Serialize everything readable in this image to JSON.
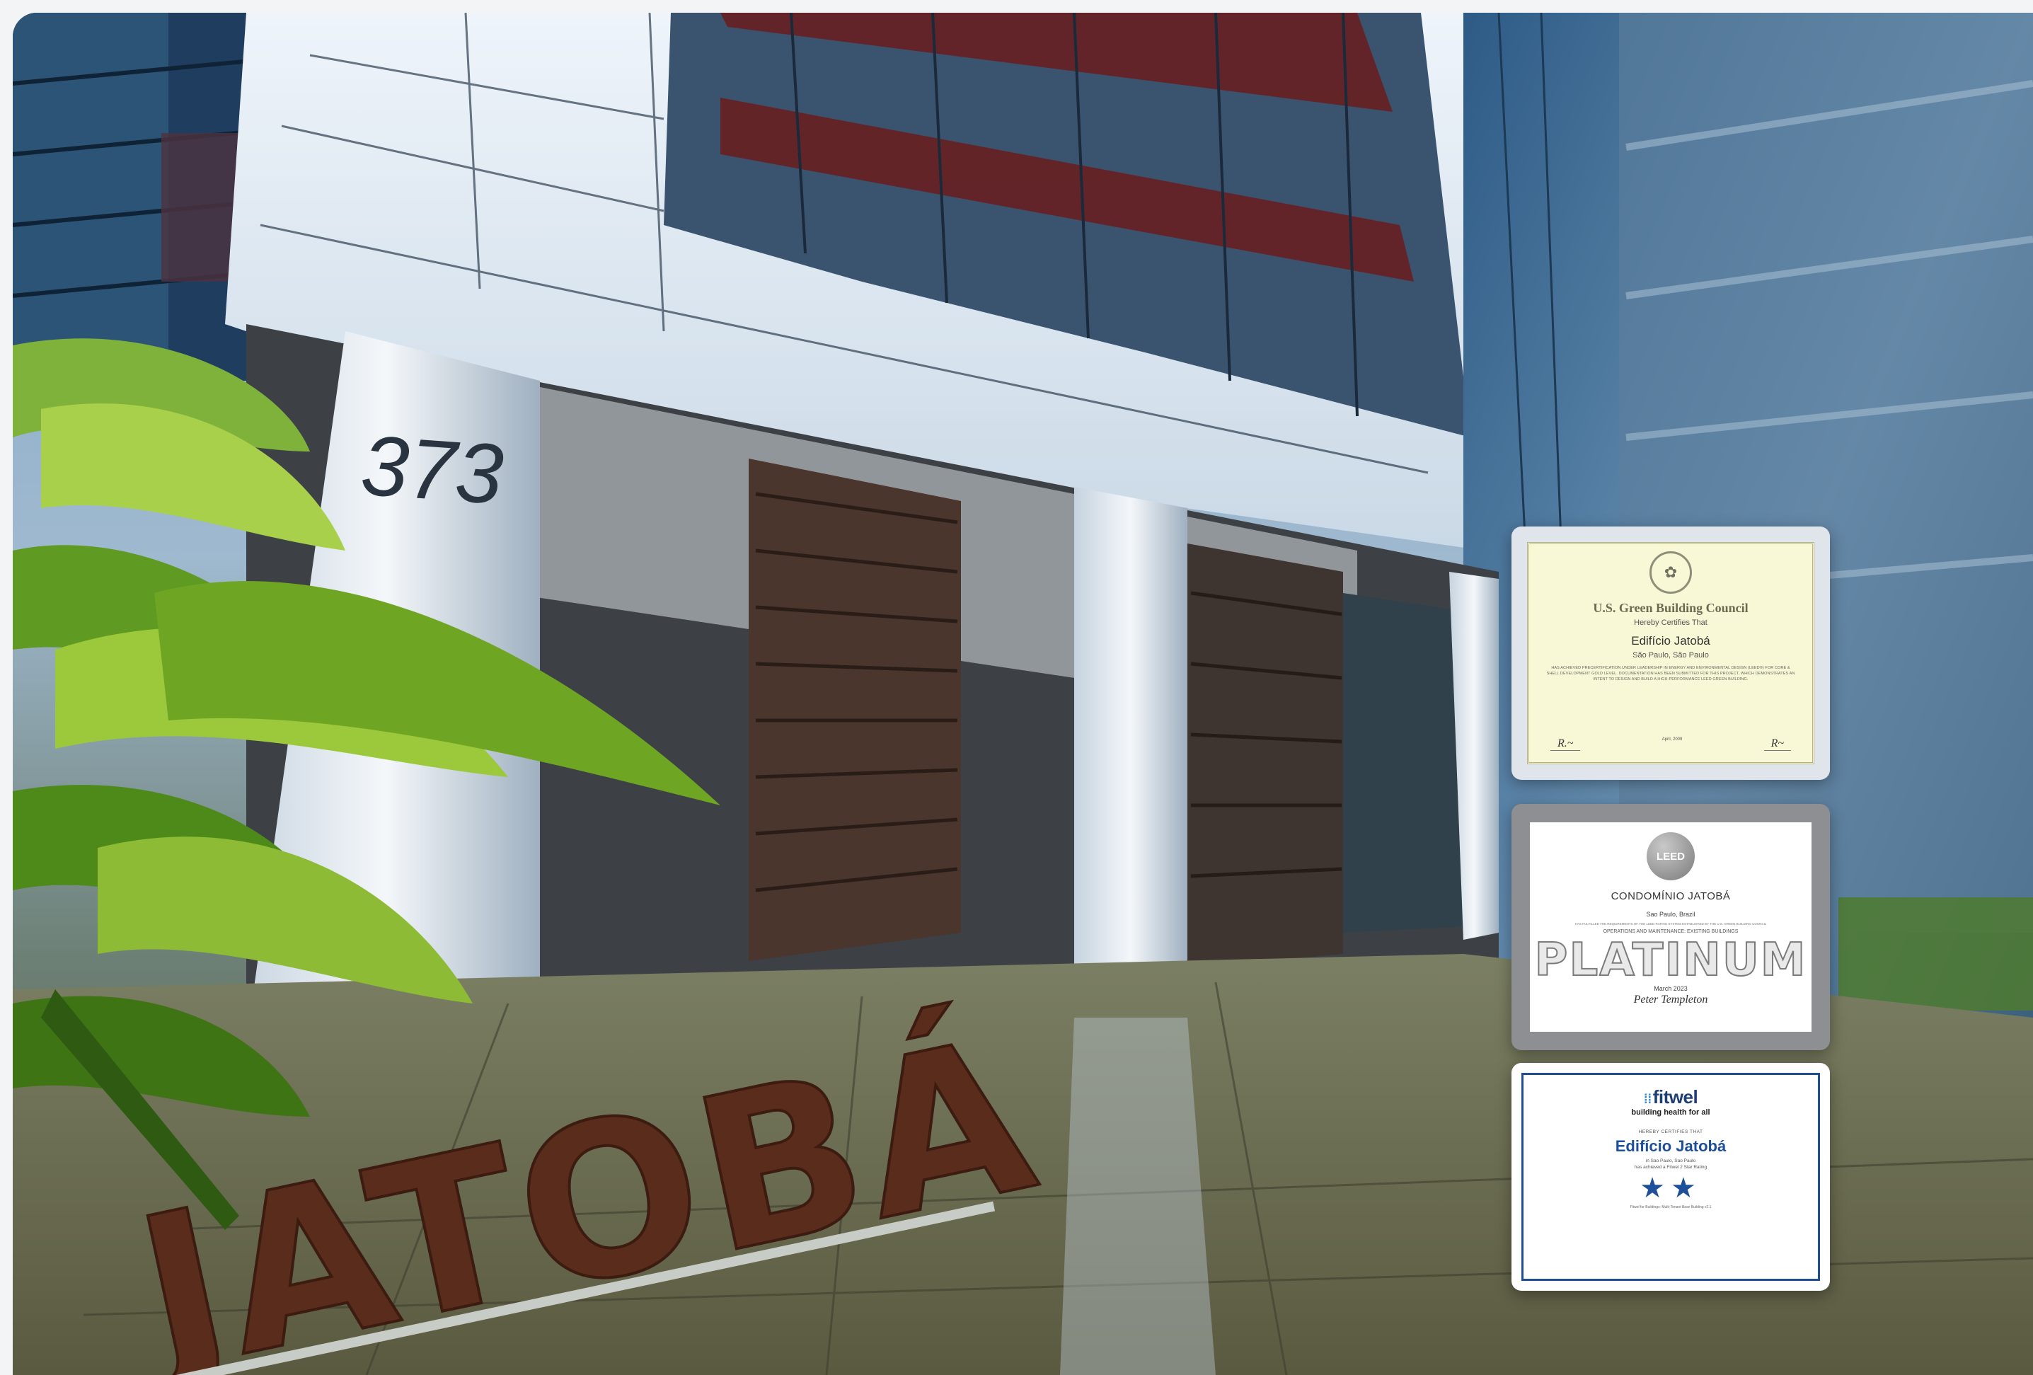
{
  "building": {
    "street_number": "373",
    "sign_lettering": "JATOBÁ"
  },
  "certificates": {
    "usgbc": {
      "organization": "U.S. Green Building Council",
      "certifies": "Hereby Certifies That",
      "building_name": "Edifício Jatobá",
      "location": "São Paulo, São Paulo",
      "body": "HAS ACHIEVED PRECERTIFICATION UNDER LEADERSHIP IN ENERGY AND ENVIRONMENTAL DESIGN (LEED®) FOR CORE & SHELL DEVELOPMENT GOLD LEVEL. DOCUMENTATION HAS BEEN SUBMITTED FOR THIS PROJECT, WHICH DEMONSTRATES AN INTENT TO DESIGN AND BUILD A HIGH-PERFORMANCE LEED GREEN BUILDING.",
      "date": "April, 2009"
    },
    "leed": {
      "seal": "LEED",
      "building_name": "CONDOMÍNIO JATOBÁ",
      "location": "Sao Paulo, Brazil",
      "fine_print": "HAS FULFILLED THE REQUIREMENTS OF THE LEED RATING SYSTEM ESTABLISHED BY THE U.S. GREEN BUILDING COUNCIL",
      "rating_system": "OPERATIONS AND MAINTENANCE: EXISTING BUILDINGS",
      "level": "PLATINUM",
      "date": "March 2023"
    },
    "fitwel": {
      "logo": "fitwel",
      "tagline": "building health for all",
      "certifies": "HEREBY CERTIFIES THAT",
      "building_name": "Edifício Jatobá",
      "location": "in Sao Paulo, Sao Paulo",
      "achievement": "has achieved a Fitwel 2 Star Rating",
      "stars": "★★",
      "star_rating": 2,
      "scorecard": "Fitwel for Buildings: Multi-Tenant Base Building v2.1"
    }
  }
}
